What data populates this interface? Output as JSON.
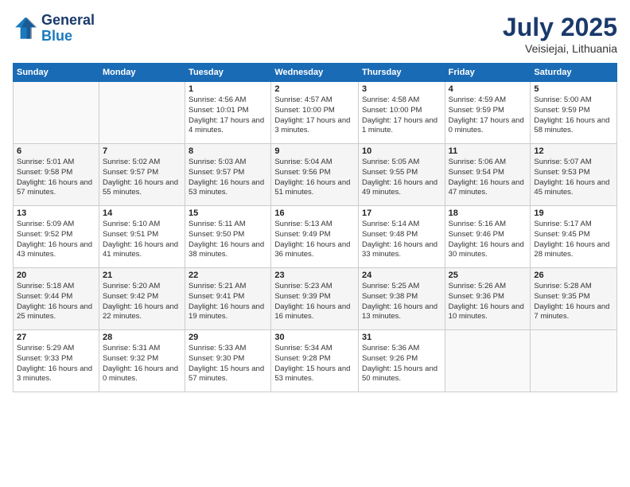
{
  "header": {
    "logo_line1": "General",
    "logo_line2": "Blue",
    "month_year": "July 2025",
    "location": "Veisiejai, Lithuania"
  },
  "weekdays": [
    "Sunday",
    "Monday",
    "Tuesday",
    "Wednesday",
    "Thursday",
    "Friday",
    "Saturday"
  ],
  "weeks": [
    [
      {
        "day": "",
        "detail": ""
      },
      {
        "day": "",
        "detail": ""
      },
      {
        "day": "1",
        "detail": "Sunrise: 4:56 AM\nSunset: 10:01 PM\nDaylight: 17 hours\nand 4 minutes."
      },
      {
        "day": "2",
        "detail": "Sunrise: 4:57 AM\nSunset: 10:00 PM\nDaylight: 17 hours\nand 3 minutes."
      },
      {
        "day": "3",
        "detail": "Sunrise: 4:58 AM\nSunset: 10:00 PM\nDaylight: 17 hours\nand 1 minute."
      },
      {
        "day": "4",
        "detail": "Sunrise: 4:59 AM\nSunset: 9:59 PM\nDaylight: 17 hours\nand 0 minutes."
      },
      {
        "day": "5",
        "detail": "Sunrise: 5:00 AM\nSunset: 9:59 PM\nDaylight: 16 hours\nand 58 minutes."
      }
    ],
    [
      {
        "day": "6",
        "detail": "Sunrise: 5:01 AM\nSunset: 9:58 PM\nDaylight: 16 hours\nand 57 minutes."
      },
      {
        "day": "7",
        "detail": "Sunrise: 5:02 AM\nSunset: 9:57 PM\nDaylight: 16 hours\nand 55 minutes."
      },
      {
        "day": "8",
        "detail": "Sunrise: 5:03 AM\nSunset: 9:57 PM\nDaylight: 16 hours\nand 53 minutes."
      },
      {
        "day": "9",
        "detail": "Sunrise: 5:04 AM\nSunset: 9:56 PM\nDaylight: 16 hours\nand 51 minutes."
      },
      {
        "day": "10",
        "detail": "Sunrise: 5:05 AM\nSunset: 9:55 PM\nDaylight: 16 hours\nand 49 minutes."
      },
      {
        "day": "11",
        "detail": "Sunrise: 5:06 AM\nSunset: 9:54 PM\nDaylight: 16 hours\nand 47 minutes."
      },
      {
        "day": "12",
        "detail": "Sunrise: 5:07 AM\nSunset: 9:53 PM\nDaylight: 16 hours\nand 45 minutes."
      }
    ],
    [
      {
        "day": "13",
        "detail": "Sunrise: 5:09 AM\nSunset: 9:52 PM\nDaylight: 16 hours\nand 43 minutes."
      },
      {
        "day": "14",
        "detail": "Sunrise: 5:10 AM\nSunset: 9:51 PM\nDaylight: 16 hours\nand 41 minutes."
      },
      {
        "day": "15",
        "detail": "Sunrise: 5:11 AM\nSunset: 9:50 PM\nDaylight: 16 hours\nand 38 minutes."
      },
      {
        "day": "16",
        "detail": "Sunrise: 5:13 AM\nSunset: 9:49 PM\nDaylight: 16 hours\nand 36 minutes."
      },
      {
        "day": "17",
        "detail": "Sunrise: 5:14 AM\nSunset: 9:48 PM\nDaylight: 16 hours\nand 33 minutes."
      },
      {
        "day": "18",
        "detail": "Sunrise: 5:16 AM\nSunset: 9:46 PM\nDaylight: 16 hours\nand 30 minutes."
      },
      {
        "day": "19",
        "detail": "Sunrise: 5:17 AM\nSunset: 9:45 PM\nDaylight: 16 hours\nand 28 minutes."
      }
    ],
    [
      {
        "day": "20",
        "detail": "Sunrise: 5:18 AM\nSunset: 9:44 PM\nDaylight: 16 hours\nand 25 minutes."
      },
      {
        "day": "21",
        "detail": "Sunrise: 5:20 AM\nSunset: 9:42 PM\nDaylight: 16 hours\nand 22 minutes."
      },
      {
        "day": "22",
        "detail": "Sunrise: 5:21 AM\nSunset: 9:41 PM\nDaylight: 16 hours\nand 19 minutes."
      },
      {
        "day": "23",
        "detail": "Sunrise: 5:23 AM\nSunset: 9:39 PM\nDaylight: 16 hours\nand 16 minutes."
      },
      {
        "day": "24",
        "detail": "Sunrise: 5:25 AM\nSunset: 9:38 PM\nDaylight: 16 hours\nand 13 minutes."
      },
      {
        "day": "25",
        "detail": "Sunrise: 5:26 AM\nSunset: 9:36 PM\nDaylight: 16 hours\nand 10 minutes."
      },
      {
        "day": "26",
        "detail": "Sunrise: 5:28 AM\nSunset: 9:35 PM\nDaylight: 16 hours\nand 7 minutes."
      }
    ],
    [
      {
        "day": "27",
        "detail": "Sunrise: 5:29 AM\nSunset: 9:33 PM\nDaylight: 16 hours\nand 3 minutes."
      },
      {
        "day": "28",
        "detail": "Sunrise: 5:31 AM\nSunset: 9:32 PM\nDaylight: 16 hours\nand 0 minutes."
      },
      {
        "day": "29",
        "detail": "Sunrise: 5:33 AM\nSunset: 9:30 PM\nDaylight: 15 hours\nand 57 minutes."
      },
      {
        "day": "30",
        "detail": "Sunrise: 5:34 AM\nSunset: 9:28 PM\nDaylight: 15 hours\nand 53 minutes."
      },
      {
        "day": "31",
        "detail": "Sunrise: 5:36 AM\nSunset: 9:26 PM\nDaylight: 15 hours\nand 50 minutes."
      },
      {
        "day": "",
        "detail": ""
      },
      {
        "day": "",
        "detail": ""
      }
    ]
  ]
}
